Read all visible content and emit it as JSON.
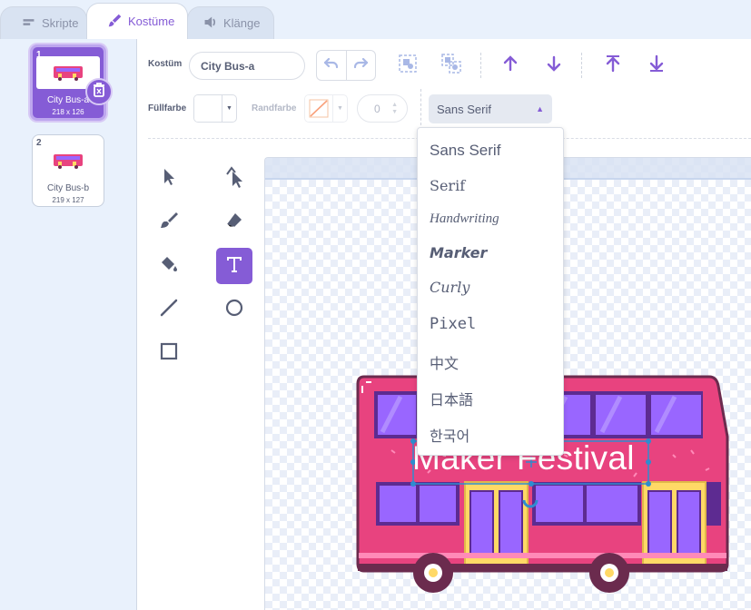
{
  "tabs": [
    {
      "label": "Skripte",
      "icon": "code-icon"
    },
    {
      "label": "Kostüme",
      "icon": "brush-icon"
    },
    {
      "label": "Klänge",
      "icon": "speaker-icon"
    }
  ],
  "costumes": [
    {
      "number": "1",
      "name": "City Bus-a",
      "size": "218 x 126",
      "selected": true
    },
    {
      "number": "2",
      "name": "City Bus-b",
      "size": "219 x 127",
      "selected": false
    }
  ],
  "toolbar": {
    "costume_label": "Kostüm",
    "costume_name": "City Bus-a",
    "fill_label": "Füllfarbe",
    "outline_label": "Randfarbe",
    "outline_width": "0",
    "font_selected": "Sans Serif"
  },
  "font_menu": [
    "Sans Serif",
    "Serif",
    "Handwriting",
    "Marker",
    "Curly",
    "Pixel",
    "中文",
    "日本語",
    "한국어"
  ],
  "canvas": {
    "text": "Maker Festival"
  },
  "colors": {
    "accent": "#855cd6",
    "bus_body": "#e8437f",
    "window": "#9966ff"
  }
}
